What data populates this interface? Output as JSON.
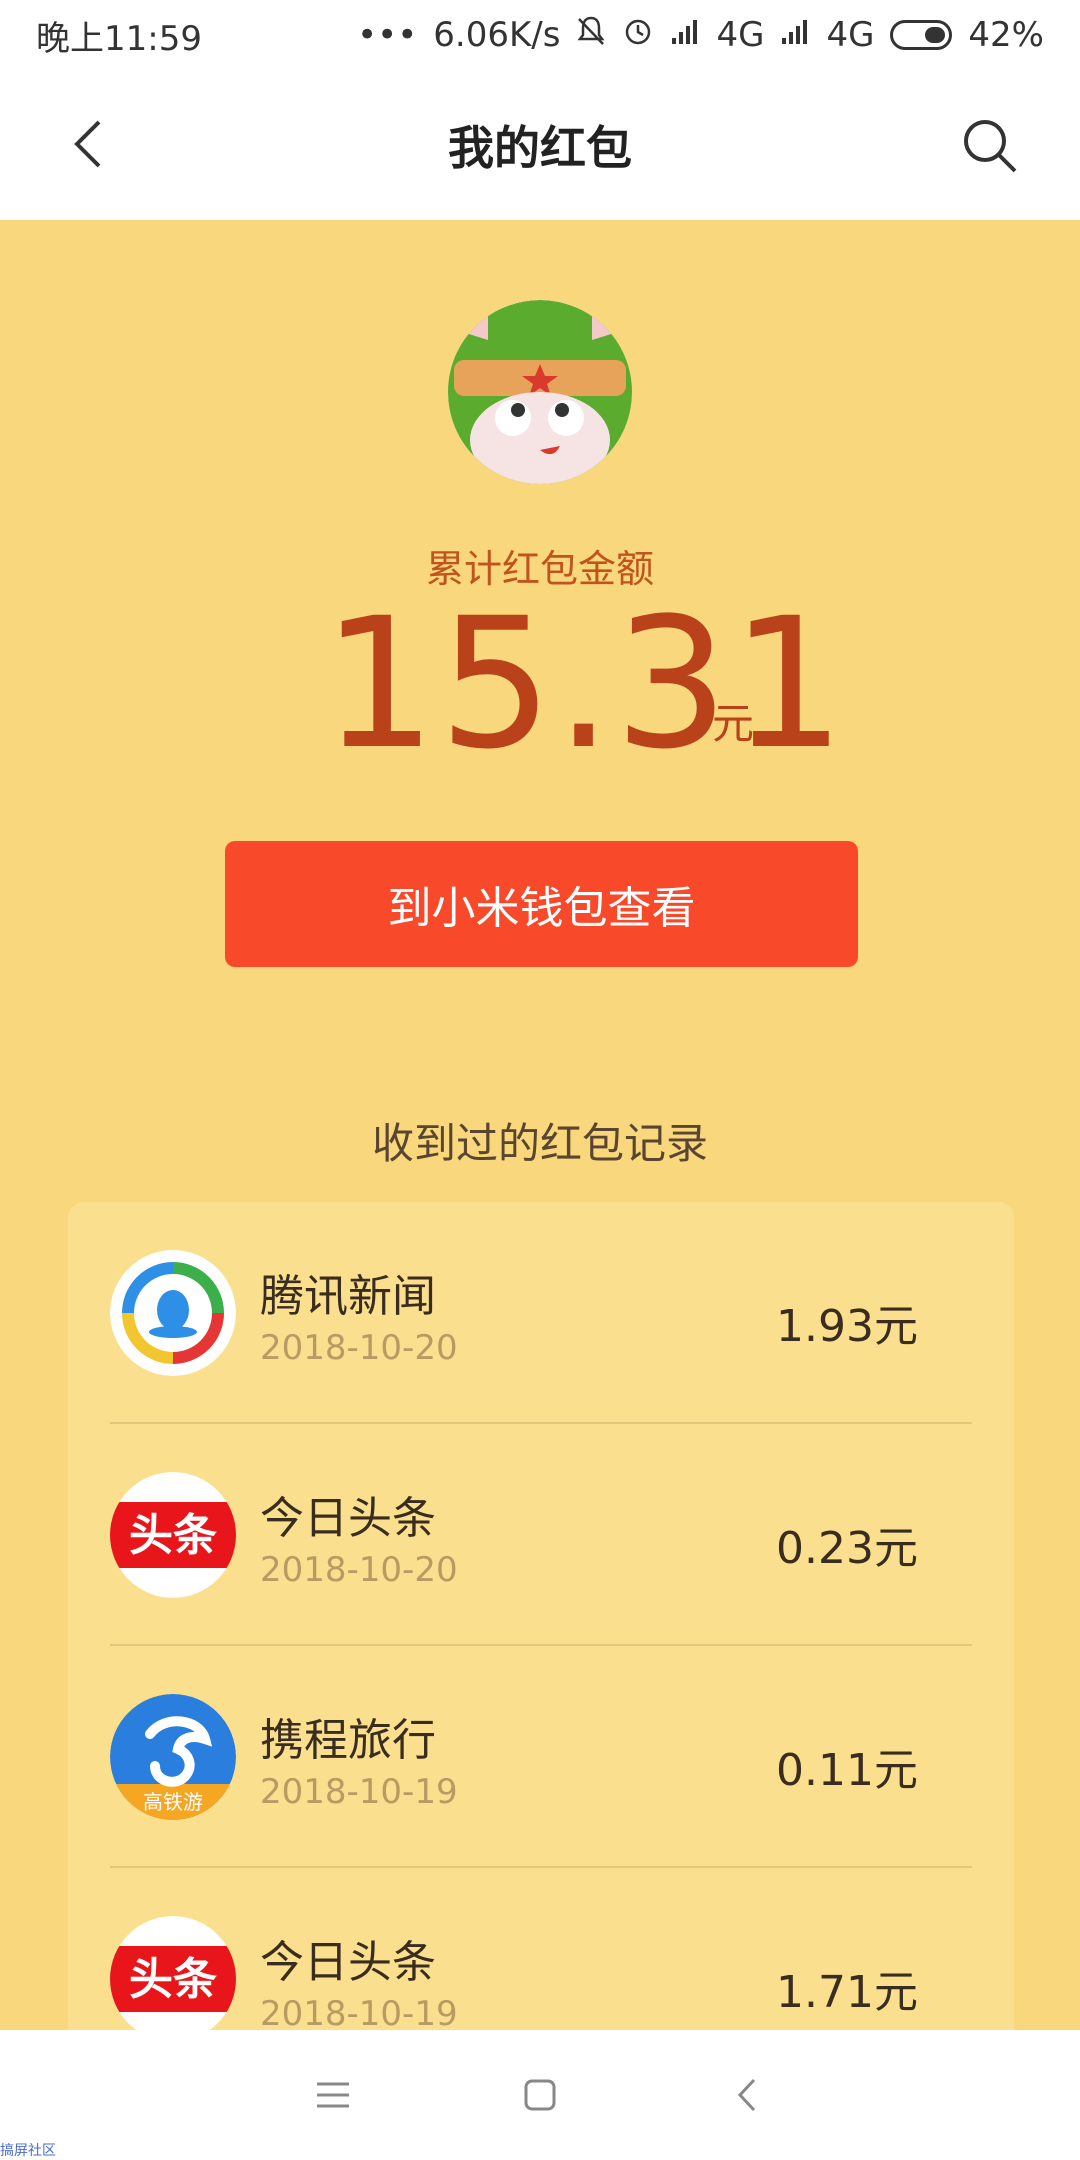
{
  "status_bar": {
    "time": "晚上11:59",
    "dots": "•••",
    "network_speed": "6.06K/s",
    "signal1": "4G",
    "signal2": "4G",
    "battery": "42%"
  },
  "header": {
    "title": "我的红包"
  },
  "summary": {
    "label": "累计红包金额",
    "amount": "15.31",
    "unit": "元",
    "wallet_button": "到小米钱包查看"
  },
  "records": {
    "title": "收到过的红包记录",
    "items": [
      {
        "name": "腾讯新闻",
        "date": "2018-10-20",
        "amount": "1.93元",
        "icon": "tencent-news-icon"
      },
      {
        "name": "今日头条",
        "date": "2018-10-20",
        "amount": "0.23元",
        "icon": "toutiao-icon"
      },
      {
        "name": "携程旅行",
        "date": "2018-10-19",
        "amount": "0.11元",
        "icon": "ctrip-icon"
      },
      {
        "name": "今日头条",
        "date": "2018-10-19",
        "amount": "1.71元",
        "icon": "toutiao-icon"
      }
    ],
    "toutiao_logo_text": "头条",
    "ctrip_logo_text": "高铁游"
  },
  "watermark": "搞屏社区"
}
